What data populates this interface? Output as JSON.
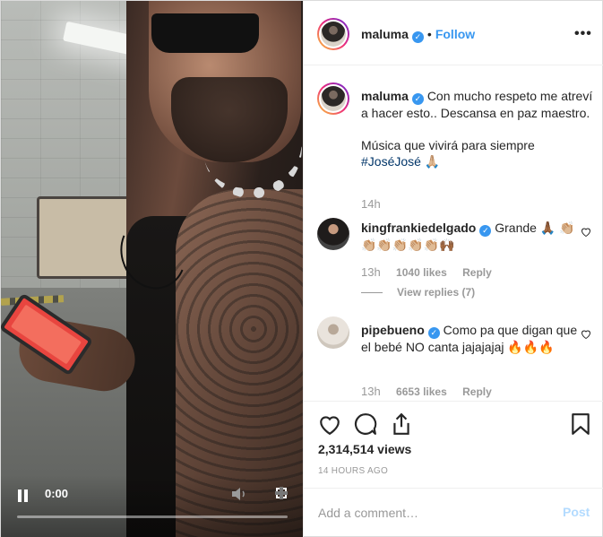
{
  "header": {
    "username": "maluma",
    "separator": "•",
    "follow_label": "Follow",
    "more_label": "•••"
  },
  "caption": {
    "username": "maluma",
    "line1": "Con mucho respeto me atreví a hacer esto.. Descansa en paz maestro.",
    "line2": "Música que vivirá para siempre",
    "hashtag": "#JoséJosé",
    "emoji": "🙏🏼",
    "time": "14h"
  },
  "comments": [
    {
      "username": "kingfrankiedelgado",
      "text": "Grande 🙏🏾 👏🏼👏🏼👏🏼👏🏼👏🏼👏🏼🙌🏾",
      "time": "13h",
      "likes": "1040 likes",
      "reply_label": "Reply",
      "view_replies": "View replies (7)"
    },
    {
      "username": "pipebueno",
      "text": "Como pa que digan que el bebé NO canta jajajajaj 🔥🔥🔥",
      "time": "13h",
      "likes": "6653 likes",
      "reply_label": "Reply"
    }
  ],
  "video": {
    "time": "0:00",
    "progress": 0.0
  },
  "stats": {
    "views": "2,314,514 views",
    "ago": "14 HOURS AGO"
  },
  "add_comment": {
    "placeholder": "Add a comment…",
    "post_label": "Post"
  },
  "icons": [
    "pause-icon",
    "speaker-icon",
    "fullscreen-icon",
    "heart-icon",
    "comment-icon",
    "share-icon",
    "bookmark-icon",
    "verified-badge-icon"
  ],
  "colors": {
    "accent": "#3897f0",
    "hashtag": "#003569",
    "muted": "#999999",
    "post_disabled": "#b3dbff"
  }
}
